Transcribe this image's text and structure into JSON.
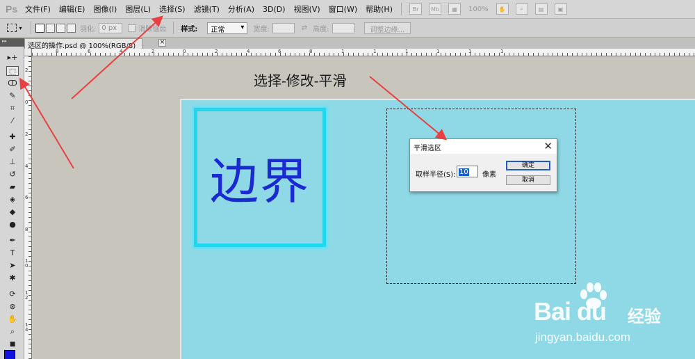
{
  "app": {
    "logo": "Ps"
  },
  "menu": [
    "文件(F)",
    "编辑(E)",
    "图像(I)",
    "图层(L)",
    "选择(S)",
    "滤镜(T)",
    "分析(A)",
    "3D(D)",
    "视图(V)",
    "窗口(W)",
    "帮助(H)"
  ],
  "menubar": {
    "br_label": "Br",
    "mb_label": "Mb",
    "zoom": "100%"
  },
  "options": {
    "feather_label": "羽化:",
    "feather_value": "0 px",
    "antialias_label": "消除锯齿",
    "style_label": "样式:",
    "style_value": "正常",
    "width_label": "宽度:",
    "height_label": "高度:",
    "refine_button": "调整边缘..."
  },
  "document": {
    "tab_title": "选区的操作.psd @ 100%(RGB/8)",
    "close": "×"
  },
  "ruler": {
    "h_ticks": [
      "8",
      "6",
      "4",
      "2",
      "0",
      "2",
      "4",
      "6",
      "8",
      "1",
      "1",
      "1",
      "1",
      "1",
      "1"
    ],
    "v_ticks": [
      "2",
      "0",
      "2",
      "4",
      "6",
      "8",
      "1 0",
      "1 2",
      "1 4"
    ]
  },
  "tools": [
    "move-tool",
    "marquee-tool",
    "lasso-tool",
    "quick-select-tool",
    "crop-tool",
    "eyedropper-tool",
    "healing-tool",
    "brush-tool",
    "stamp-tool",
    "history-brush-tool",
    "eraser-tool",
    "gradient-tool",
    "blur-tool",
    "dodge-tool",
    "pen-tool",
    "type-tool",
    "path-select-tool",
    "shape-tool",
    "3d-rotate-tool",
    "3d-orbit-tool",
    "hand-tool",
    "zoom-tool"
  ],
  "colors": {
    "foreground": "#1212e0",
    "canvas": "#8fd9e6",
    "border_stroke": "#21d6ef",
    "text": "#1a2ad0",
    "arrow": "#e84040"
  },
  "canvas": {
    "border_text": "边界"
  },
  "caption": "选择-修改-平滑",
  "dialog": {
    "title": "平滑选区",
    "close": "✕",
    "radius_label": "取样半径(S):",
    "radius_value": "10",
    "unit": "像素",
    "ok_button": "确定",
    "cancel_button": "取消"
  },
  "watermark": {
    "logo": "Bai du",
    "cn": "经验",
    "url": "jingyan.baidu.com"
  }
}
